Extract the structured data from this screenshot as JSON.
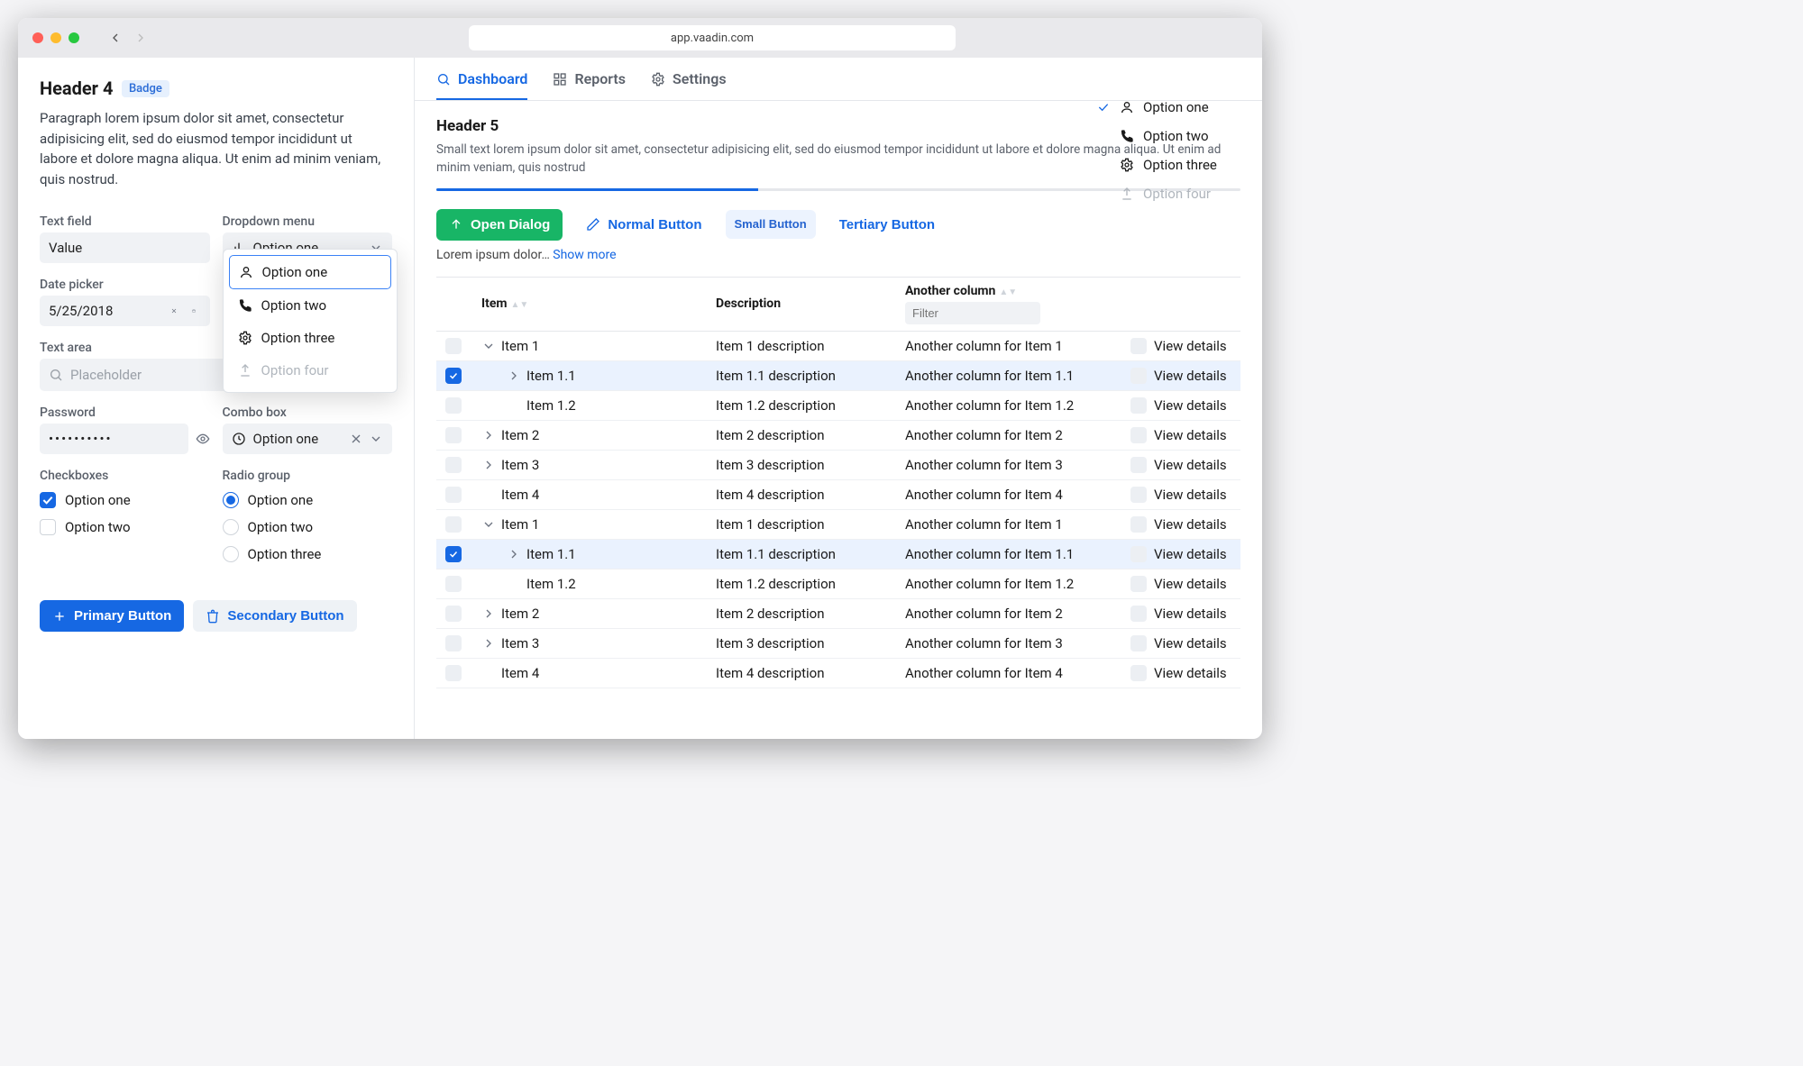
{
  "url": "app.vaadin.com",
  "sidebar": {
    "header": "Header 4",
    "badge": "Badge",
    "paragraph": "Paragraph lorem ipsum dolor sit amet, consectetur adipisicing elit, sed do eiusmod tempor incididunt ut labore et dolore magna aliqua. Ut enim ad minim veniam, quis nostrud.",
    "text_field": {
      "label": "Text field",
      "value": "Value"
    },
    "dropdown": {
      "label": "Dropdown menu",
      "value": "Option one",
      "options": [
        "Option one",
        "Option two",
        "Option three",
        "Option four"
      ]
    },
    "date": {
      "label": "Date picker",
      "value": "5/25/2018"
    },
    "textarea": {
      "label": "Text area",
      "placeholder": "Placeholder"
    },
    "password": {
      "label": "Password",
      "value": "••••••••••"
    },
    "combo": {
      "label": "Combo box",
      "value": "Option one"
    },
    "checkboxes": {
      "label": "Checkboxes",
      "options": [
        {
          "label": "Option one",
          "checked": true
        },
        {
          "label": "Option two",
          "checked": false
        }
      ]
    },
    "radios": {
      "label": "Radio group",
      "options": [
        {
          "label": "Option one",
          "checked": true
        },
        {
          "label": "Option two",
          "checked": false
        },
        {
          "label": "Option three",
          "checked": false
        }
      ]
    },
    "primary_btn": "Primary Button",
    "secondary_btn": "Secondary Button"
  },
  "tabs": [
    {
      "label": "Dashboard",
      "icon": "search-icon",
      "active": true
    },
    {
      "label": "Reports",
      "icon": "grid-icon"
    },
    {
      "label": "Settings",
      "icon": "gear-icon"
    }
  ],
  "main": {
    "header": "Header 5",
    "small": "Small text lorem ipsum dolor sit amet, consectetur adipisicing elit, sed do eiusmod tempor incididunt ut labore et dolore magna aliqua. Ut enim ad minim veniam, quis nostrud",
    "progress": 40,
    "open_dialog": "Open Dialog",
    "normal_btn": "Normal Button",
    "small_btn": "Small Button",
    "tertiary_btn": "Tertiary Button",
    "under_text": "Lorem ipsum dolor… ",
    "show_more": "Show more"
  },
  "right_options": [
    {
      "label": "Option one",
      "icon": "user-icon",
      "checked": true
    },
    {
      "label": "Option two",
      "icon": "phone-icon"
    },
    {
      "label": "Option three",
      "icon": "gear-icon"
    },
    {
      "label": "Option four",
      "icon": "upload-icon",
      "disabled": true
    }
  ],
  "grid": {
    "headers": {
      "item": "Item",
      "desc": "Description",
      "another": "Another column",
      "filter_placeholder": "Filter",
      "view": "View details"
    },
    "rows": [
      {
        "indent": 0,
        "toggle": "down",
        "item": "Item 1",
        "desc": "Item 1 description",
        "another": "Another column for Item 1",
        "checked": false
      },
      {
        "indent": 1,
        "toggle": "right",
        "item": "Item 1.1",
        "desc": "Item 1.1 description",
        "another": "Another column for Item 1.1",
        "checked": true
      },
      {
        "indent": 1,
        "toggle": "",
        "item": "Item 1.2",
        "desc": "Item 1.2 description",
        "another": "Another column for Item 1.2",
        "checked": false
      },
      {
        "indent": 0,
        "toggle": "right",
        "item": "Item 2",
        "desc": "Item 2 description",
        "another": "Another column for Item 2",
        "checked": false
      },
      {
        "indent": 0,
        "toggle": "right",
        "item": "Item 3",
        "desc": "Item 3 description",
        "another": "Another column for Item 3",
        "checked": false
      },
      {
        "indent": 0,
        "toggle": "",
        "item": "Item 4",
        "desc": "Item 4 description",
        "another": "Another column for Item 4",
        "checked": false
      },
      {
        "indent": 0,
        "toggle": "down",
        "item": "Item 1",
        "desc": "Item 1 description",
        "another": "Another column for Item 1",
        "checked": false
      },
      {
        "indent": 1,
        "toggle": "right",
        "item": "Item 1.1",
        "desc": "Item 1.1 description",
        "another": "Another column for Item 1.1",
        "checked": true
      },
      {
        "indent": 1,
        "toggle": "",
        "item": "Item 1.2",
        "desc": "Item 1.2 description",
        "another": "Another column for Item 1.2",
        "checked": false
      },
      {
        "indent": 0,
        "toggle": "right",
        "item": "Item 2",
        "desc": "Item 2 description",
        "another": "Another column for Item 2",
        "checked": false
      },
      {
        "indent": 0,
        "toggle": "right",
        "item": "Item 3",
        "desc": "Item 3 description",
        "another": "Another column for Item 3",
        "checked": false
      },
      {
        "indent": 0,
        "toggle": "",
        "item": "Item 4",
        "desc": "Item 4 description",
        "another": "Another column for Item 4",
        "checked": false
      }
    ]
  }
}
